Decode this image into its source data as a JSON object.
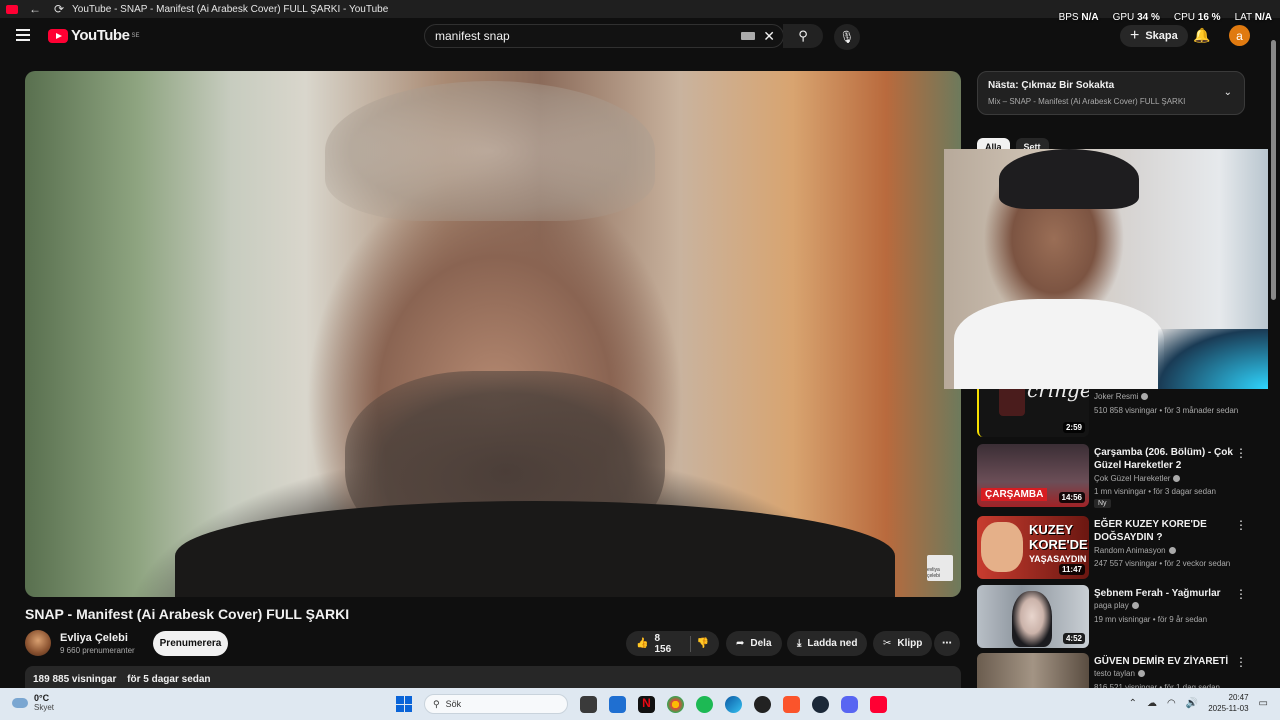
{
  "window": {
    "title": "YouTube - SNAP - Manifest (Ai Arabesk Cover) FULL ŞARKI - YouTube"
  },
  "perf": {
    "bps_label": "BPS",
    "bps_value": "N/A",
    "gpu_label": "GPU",
    "gpu_value": "34 %",
    "cpu_label": "CPU",
    "cpu_value": "16 %",
    "lat_label": "LAT",
    "lat_value": "N/A"
  },
  "masthead": {
    "logo_text": "YouTube",
    "region": "SE",
    "search_value": "manifest snap",
    "create_label": "Skapa",
    "avatar_letter": "a"
  },
  "player": {
    "watermark": "evliya çelebi"
  },
  "video": {
    "title": "SNAP - Manifest (Ai Arabesk Cover) FULL ŞARKI",
    "channel": "Evliya Çelebi",
    "subscribers": "9 660 prenumeranter",
    "subscribe_label": "Prenumerera",
    "likes": "8 156",
    "share_label": "Dela",
    "download_label": "Ladda ned",
    "clip_label": "Klipp",
    "views": "189 885 visningar",
    "age": "för 5 dagar sedan"
  },
  "sidebar": {
    "upnext_prefix": "Nästa:",
    "upnext_title": "Çıkmaz Bir Sokakta",
    "upnext_mix": "Mix – SNAP - Manifest (Ai Arabesk Cover) FULL ŞARKI",
    "chips": [
      "Alla",
      "Sett"
    ],
    "items": [
      {
        "title": "",
        "thumb_text": "cringe",
        "channel": "Joker Resmi",
        "meta": "510 858 visningar • för 3 månader sedan",
        "duration": "2:59",
        "badge": ""
      },
      {
        "title": "Çarşamba (206. Bölüm) - Çok Güzel Hareketler 2",
        "thumb_text": "ÇARŞAMBA",
        "channel": "Çok Güzel Hareketler",
        "meta": "1 mn visningar • för 3 dagar sedan",
        "duration": "14:56",
        "badge": "Ny"
      },
      {
        "title": "EĞER KUZEY KORE'DE DOĞSAYDIN ?",
        "thumb_text": "KUZEY KORE'DE",
        "thumb_text2": "YAŞASAYDIN",
        "channel": "Random Animasyon",
        "meta": "247 557 visningar • för 2 veckor sedan",
        "duration": "11:47",
        "badge": ""
      },
      {
        "title": "Şebnem Ferah - Yağmurlar",
        "channel": "paga play",
        "meta": "19 mn visningar • för 9 år sedan",
        "duration": "4:52",
        "badge": ""
      },
      {
        "title": "GÜVEN DEMİR EV ZİYARETİ",
        "channel": "testo taylan",
        "meta": "816 521 visningar • för 1 dag sedan",
        "duration": "",
        "badge": ""
      }
    ]
  },
  "taskbar": {
    "weather_temp": "0°C",
    "weather_desc": "Skyet",
    "search_placeholder": "Sök",
    "time": "20:47",
    "date": "2025-11-03"
  },
  "colors": {
    "bg": "#0f0f0f",
    "brand_red": "#ff0033",
    "chip_bg": "#272727",
    "taskbar_bg": "#dfe8f1"
  }
}
